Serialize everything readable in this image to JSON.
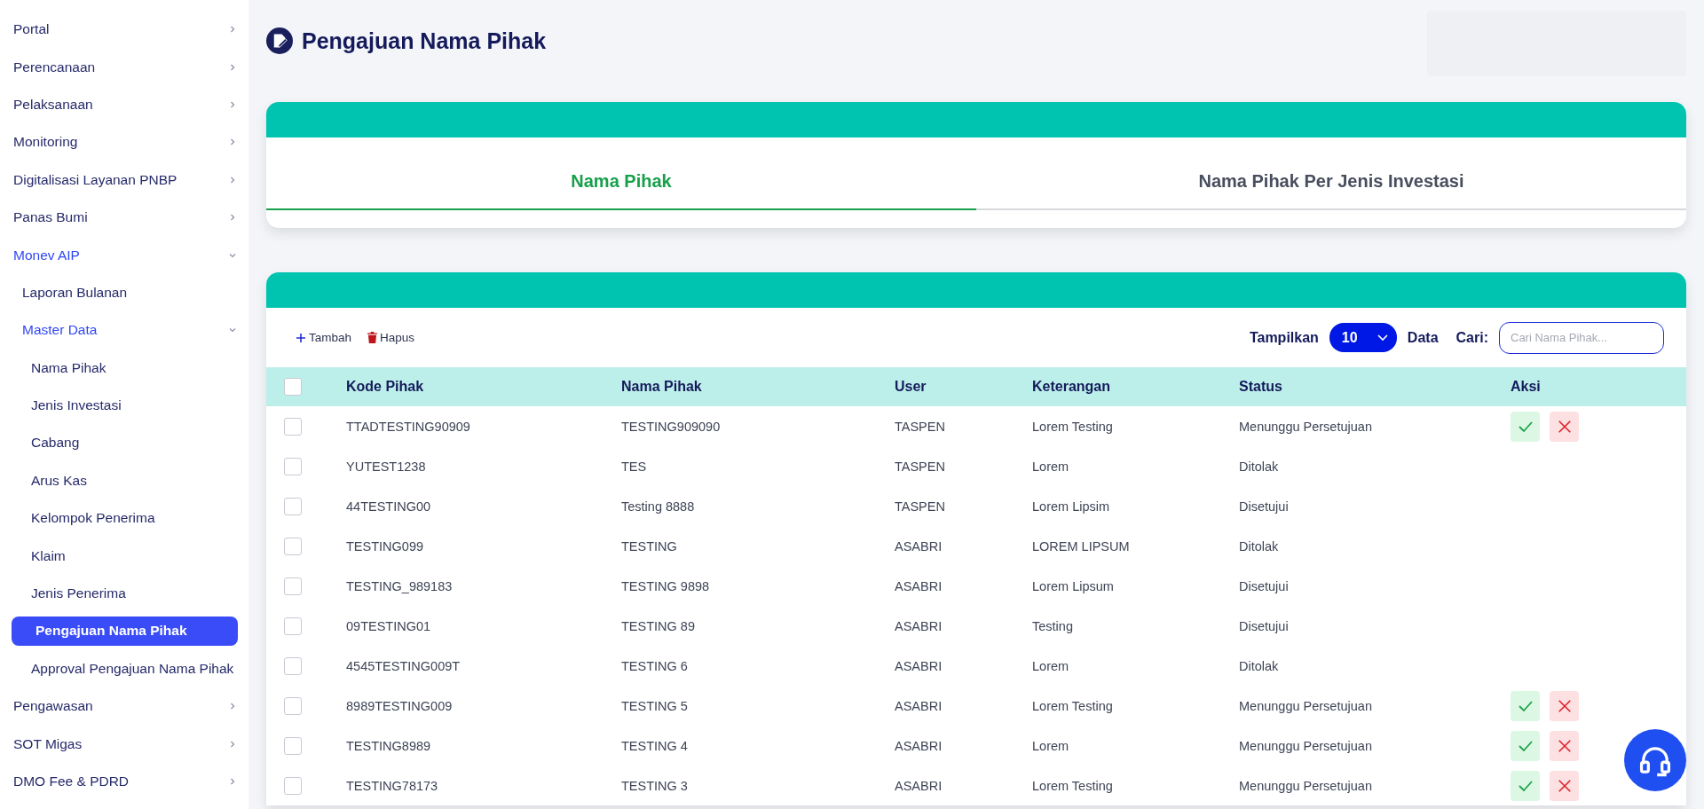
{
  "sidebar": {
    "items": [
      {
        "label": "Portal",
        "expanded": false
      },
      {
        "label": "Perencanaan",
        "expanded": false
      },
      {
        "label": "Pelaksanaan",
        "expanded": false
      },
      {
        "label": "Monitoring",
        "expanded": false
      },
      {
        "label": "Digitalisasi Layanan PNBP",
        "expanded": false
      },
      {
        "label": "Panas Bumi",
        "expanded": false
      },
      {
        "label": "Monev AIP",
        "expanded": true,
        "children": [
          {
            "label": "Laporan Bulanan",
            "selected": false
          },
          {
            "label": "Master Data",
            "expanded": true,
            "children": [
              {
                "label": "Nama Pihak",
                "selected": false
              },
              {
                "label": "Jenis Investasi",
                "selected": false
              },
              {
                "label": "Cabang",
                "selected": false
              },
              {
                "label": "Arus Kas",
                "selected": false
              },
              {
                "label": "Kelompok Penerima",
                "selected": false
              },
              {
                "label": "Klaim",
                "selected": false
              },
              {
                "label": "Jenis Penerima",
                "selected": false
              },
              {
                "label": "Pengajuan Nama Pihak",
                "selected": true
              },
              {
                "label": "Approval Pengajuan Nama Pihak",
                "selected": false
              }
            ]
          }
        ]
      },
      {
        "label": "Pengawasan",
        "expanded": false
      },
      {
        "label": "SOT Migas",
        "expanded": false
      },
      {
        "label": "DMO Fee & PDRD",
        "expanded": false
      }
    ]
  },
  "page_title": "Pengajuan Nama Pihak",
  "tabs": [
    {
      "label": "Nama Pihak",
      "selected": true
    },
    {
      "label": "Nama Pihak Per Jenis Investasi",
      "selected": false
    }
  ],
  "toolbar": {
    "add_label": "Tambah",
    "delete_label": "Hapus",
    "show_label": "Tampilkan",
    "page_size": "10",
    "show_suffix": "Data",
    "search_label": "Cari:",
    "search_placeholder": "Cari Nama Pihak..."
  },
  "table": {
    "select_all_checked": false,
    "columns": [
      "Kode Pihak",
      "Nama Pihak",
      "User",
      "Keterangan",
      "Status",
      "Aksi"
    ],
    "rows": [
      {
        "checked": false,
        "cells": [
          "TTADTESTING90909",
          "TESTING909090",
          "TASPEN",
          "Lorem Testing",
          "Menunggu Persetujuan"
        ],
        "actions": true
      },
      {
        "checked": false,
        "cells": [
          "YUTEST1238",
          "TES",
          "TASPEN",
          "Lorem",
          "Ditolak"
        ],
        "actions": false
      },
      {
        "checked": false,
        "cells": [
          "44TESTING00",
          "Testing 8888",
          "TASPEN",
          "Lorem Lipsim",
          "Disetujui"
        ],
        "actions": false
      },
      {
        "checked": false,
        "cells": [
          "TESTING099",
          "TESTING",
          "ASABRI",
          "LOREM LIPSUM",
          "Ditolak"
        ],
        "actions": false
      },
      {
        "checked": false,
        "cells": [
          "TESTING_989183",
          "TESTING 9898",
          "ASABRI",
          "Lorem Lipsum",
          "Disetujui"
        ],
        "actions": false
      },
      {
        "checked": false,
        "cells": [
          "09TESTING01",
          "TESTING 89",
          "ASABRI",
          "Testing",
          "Disetujui"
        ],
        "actions": false
      },
      {
        "checked": false,
        "cells": [
          "4545TESTING009T",
          "TESTING 6",
          "ASABRI",
          "Lorem",
          "Ditolak"
        ],
        "actions": false
      },
      {
        "checked": false,
        "cells": [
          "8989TESTING009",
          "TESTING 5",
          "ASABRI",
          "Lorem Testing",
          "Menunggu Persetujuan"
        ],
        "actions": true
      },
      {
        "checked": false,
        "cells": [
          "TESTING8989",
          "TESTING 4",
          "ASABRI",
          "Lorem",
          "Menunggu Persetujuan"
        ],
        "actions": true
      },
      {
        "checked": false,
        "cells": [
          "TESTING78173",
          "TESTING 3",
          "ASABRI",
          "Lorem Testing",
          "Menunggu Persetujuan"
        ],
        "actions": true
      }
    ]
  }
}
